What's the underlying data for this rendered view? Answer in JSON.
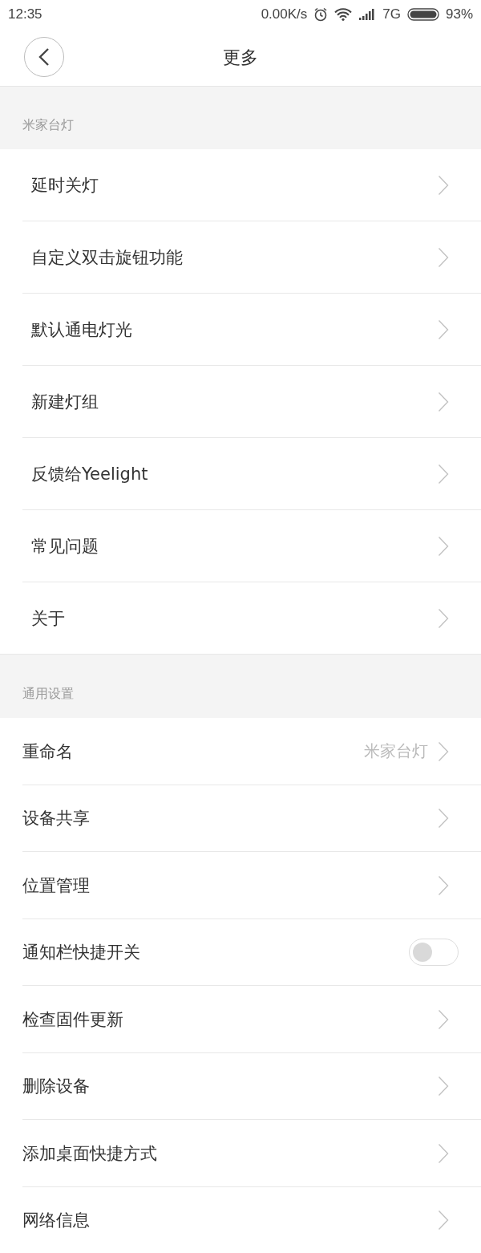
{
  "status_bar": {
    "time": "12:35",
    "net_speed": "0.00K/s",
    "network": "7G",
    "battery": "93%"
  },
  "header": {
    "title": "更多"
  },
  "sections": [
    {
      "title": "米家台灯",
      "items": [
        {
          "kind": "link",
          "label": "延时关灯"
        },
        {
          "kind": "link",
          "label": "自定义双击旋钮功能"
        },
        {
          "kind": "link",
          "label": "默认通电灯光"
        },
        {
          "kind": "link",
          "label": "新建灯组"
        },
        {
          "kind": "link",
          "label": "反馈给Yeelight"
        },
        {
          "kind": "link",
          "label": "常见问题"
        },
        {
          "kind": "link",
          "label": "关于"
        }
      ]
    },
    {
      "title": "通用设置",
      "items": [
        {
          "kind": "link",
          "label": "重命名",
          "value": "米家台灯"
        },
        {
          "kind": "link",
          "label": "设备共享"
        },
        {
          "kind": "link",
          "label": "位置管理"
        },
        {
          "kind": "toggle",
          "label": "通知栏快捷开关",
          "on": false
        },
        {
          "kind": "link",
          "label": "检查固件更新"
        },
        {
          "kind": "link",
          "label": "删除设备"
        },
        {
          "kind": "link",
          "label": "添加桌面快捷方式"
        },
        {
          "kind": "link",
          "label": "网络信息"
        }
      ]
    }
  ]
}
